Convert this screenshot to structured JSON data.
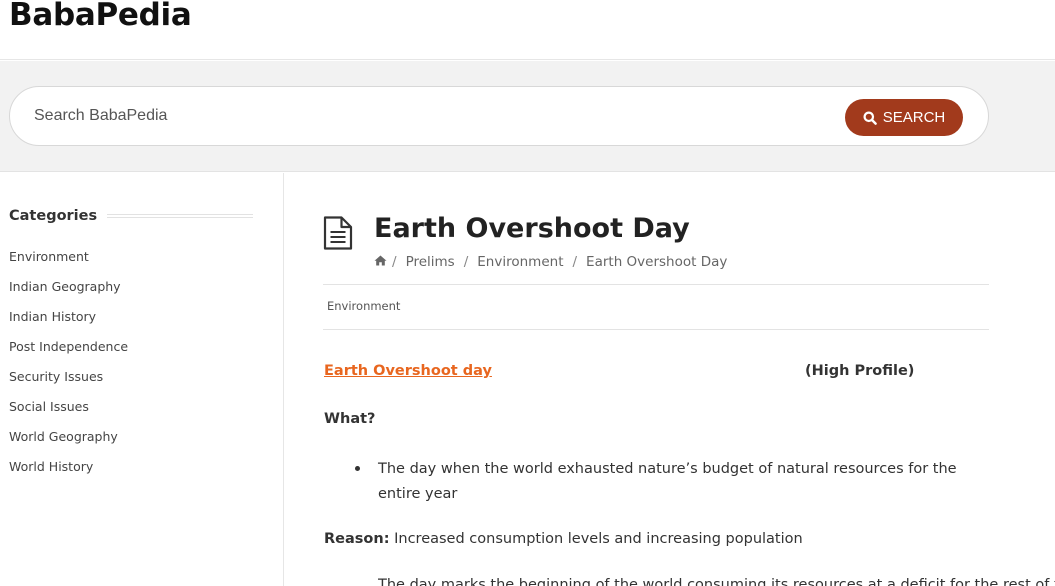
{
  "site": {
    "logo": "BabaPedia"
  },
  "search": {
    "placeholder": "Search BabaPedia",
    "button_label": "SEARCH",
    "button_color": "#a23a1c"
  },
  "sidebar": {
    "title": "Categories",
    "items": [
      {
        "label": "Environment"
      },
      {
        "label": "Indian Geography"
      },
      {
        "label": "Indian History"
      },
      {
        "label": "Post Independence"
      },
      {
        "label": "Security Issues"
      },
      {
        "label": "Social Issues"
      },
      {
        "label": "World Geography"
      },
      {
        "label": "World History"
      }
    ]
  },
  "article": {
    "icon": "document-icon",
    "title": "Earth Overshoot Day",
    "breadcrumb": {
      "home_icon": "home-icon",
      "items": [
        "Prelims",
        "Environment",
        "Earth Overshoot Day"
      ],
      "separator": "/"
    },
    "tag": "Environment",
    "link_text": "Earth Overshoot day",
    "link_color": "#e8661f",
    "profile": "(High Profile)",
    "what_heading": "What?",
    "bullets": [
      "The day when the world exhausted nature’s budget of natural resources for the entire year"
    ],
    "reason_label": "Reason:",
    "reason_text": " Increased consumption levels and increasing population",
    "trailing_text": "The day marks the beginning of the world consuming its resources at a deficit for the rest of the year"
  }
}
